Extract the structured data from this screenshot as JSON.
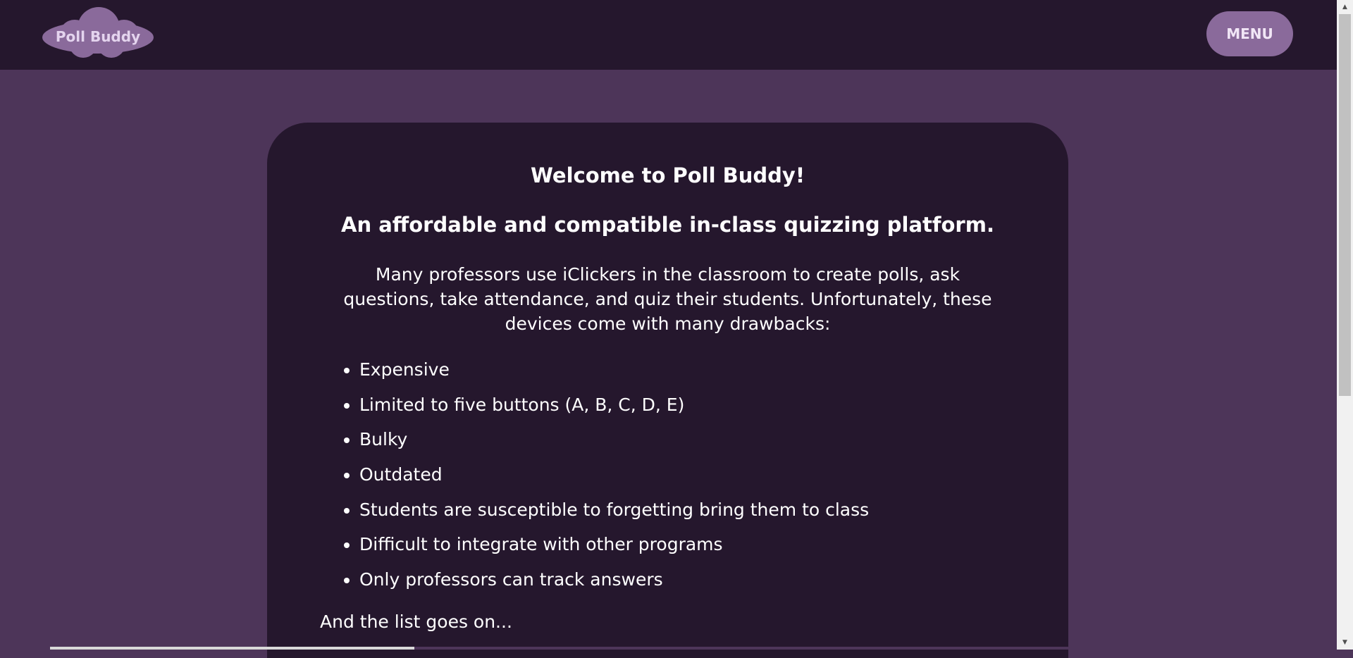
{
  "header": {
    "logo_text": "Poll Buddy",
    "menu_label": "MENU"
  },
  "card": {
    "title": "Welcome to Poll Buddy!",
    "subtitle": "An affordable and compatible in-class quizzing platform.",
    "intro": "Many professors use iClickers in the classroom to create polls, ask questions, take attendance, and quiz their students. Unfortunately, these devices come with many drawbacks:",
    "drawbacks": [
      "Expensive",
      "Limited to five buttons (A, B, C, D, E)",
      "Bulky",
      "Outdated",
      "Students are susceptible to forgetting bring them to class",
      "Difficult to integrate with other programs",
      "Only professors can track answers"
    ],
    "outro": "And the list goes on..."
  },
  "colors": {
    "page_background": "#4d3559",
    "header_background": "#25172d",
    "card_background": "#25172d",
    "accent": "#8a6a9b",
    "text": "#ffffff"
  },
  "icons": {
    "logo": "cloud-logo",
    "scroll_up": "scroll-up-arrow-icon",
    "scroll_down": "scroll-down-arrow-icon"
  }
}
